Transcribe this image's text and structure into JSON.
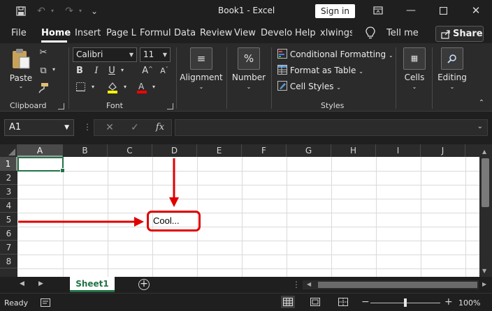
{
  "window": {
    "title": "Book1  -  Excel",
    "signin_label": "Sign in",
    "qa_more": "⌄"
  },
  "tabs": [
    {
      "label": "File"
    },
    {
      "label": "Home"
    },
    {
      "label": "Insert"
    },
    {
      "label": "Page L"
    },
    {
      "label": "Formul"
    },
    {
      "label": "Data"
    },
    {
      "label": "Review"
    },
    {
      "label": "View"
    },
    {
      "label": "Develo"
    },
    {
      "label": "Help"
    },
    {
      "label": "xlwings"
    },
    {
      "label": "Tell me"
    }
  ],
  "share_label": "Share",
  "ribbon": {
    "clipboard": {
      "paste_label": "Paste",
      "group_label": "Clipboard"
    },
    "font": {
      "font_name": "Calibri",
      "font_size": "11",
      "group_label": "Font",
      "bold": "B",
      "italic": "I",
      "underline": "U"
    },
    "alignment_label": "Alignment",
    "number_label": "Number",
    "styles": {
      "conditional": "Conditional Formatting",
      "format_table": "Format as Table",
      "cell_styles": "Cell Styles",
      "group_label": "Styles"
    },
    "cells_label": "Cells",
    "editing_label": "Editing"
  },
  "formula_bar": {
    "name_box": "A1",
    "fx": "fx",
    "formula": ""
  },
  "grid": {
    "columns": [
      "A",
      "B",
      "C",
      "D",
      "E",
      "F",
      "G",
      "H",
      "I",
      "J"
    ],
    "rows": [
      "1",
      "2",
      "3",
      "4",
      "5",
      "6",
      "7",
      "8"
    ],
    "cell_d5": "Cool..."
  },
  "sheets": [
    {
      "label": "Sheet1"
    }
  ],
  "status": {
    "ready": "Ready",
    "zoom": "100%"
  },
  "colors": {
    "accent": "#217346",
    "annotation": "#e00000"
  }
}
